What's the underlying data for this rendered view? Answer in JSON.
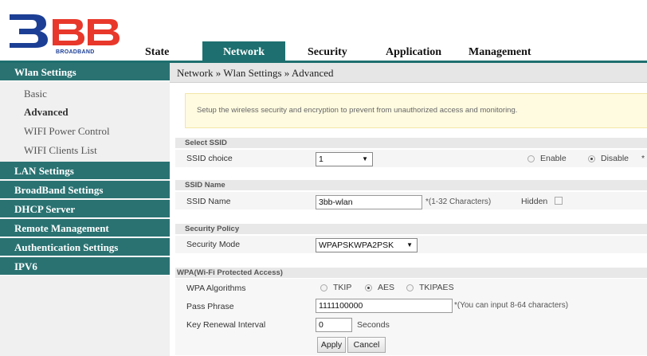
{
  "logo": {
    "brand": "BROADBAND",
    "name": "3BB"
  },
  "nav": {
    "state": "State",
    "network": "Network",
    "security": "Security",
    "application": "Application",
    "management": "Management"
  },
  "sidebar": {
    "wlan_settings": "Wlan Settings",
    "items": [
      "Basic",
      "Advanced",
      "WIFI Power Control",
      "WIFI Clients List"
    ],
    "lan_settings": "LAN Settings",
    "broadband_settings": "BroadBand Settings",
    "dhcp_server": "DHCP Server",
    "remote_management": "Remote Management",
    "authentication_settings": "Authentication Settings",
    "ipv6": "IPV6"
  },
  "breadcrumb": "Network » Wlan Settings » Advanced",
  "notice": "Setup the wireless security and encryption to prevent from unauthorized access and monitoring.",
  "select_ssid": {
    "section": "Select SSID",
    "label": "SSID choice",
    "value": "1",
    "enable": "Enable",
    "disable": "Disable",
    "selected": "Disable",
    "star": "*"
  },
  "ssid_name": {
    "section": "SSID Name",
    "label": "SSID Name",
    "value": "3bb-wlan",
    "note": "*(1-32 Characters)",
    "hidden": "Hidden"
  },
  "security_policy": {
    "section": "Security Policy",
    "label": "Security Mode",
    "value": "WPAPSKWPA2PSK"
  },
  "wpa": {
    "section": "WPA(Wi-Fi Protected Access)",
    "algorithms_label": "WPA Algorithms",
    "tkip": "TKIP",
    "aes": "AES",
    "tkipaes": "TKIPAES",
    "selected": "AES",
    "pass_label": "Pass Phrase",
    "pass_value": "1111100000",
    "pass_note": "*(You can input 8-64 characters)",
    "renewal_label": "Key Renewal Interval",
    "renewal_value": "0",
    "renewal_unit": "Seconds"
  },
  "buttons": {
    "apply": "Apply",
    "cancel": "Cancel"
  },
  "colors": {
    "accent": "#2a7272",
    "notice_bg": "#fffbe0"
  }
}
